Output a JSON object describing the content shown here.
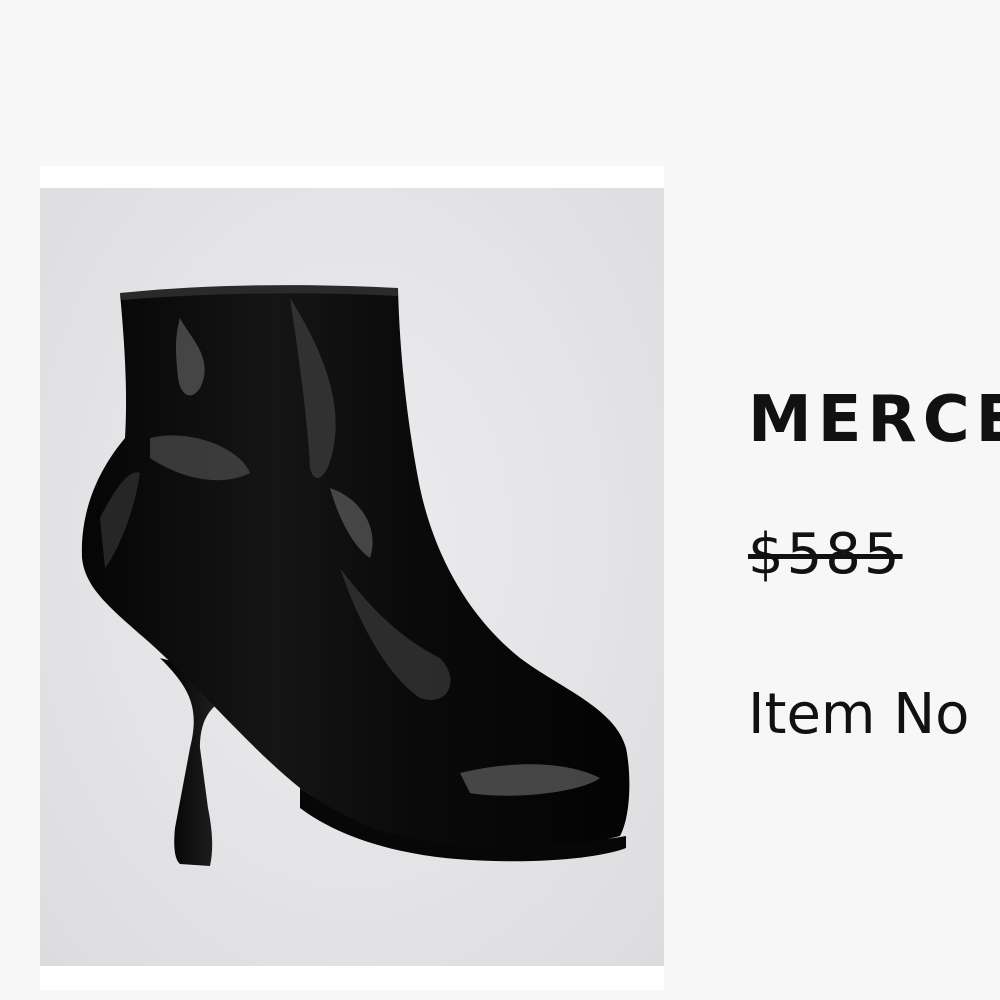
{
  "product": {
    "image_alt": "Black patent leather ankle boot with sculpted flared heel",
    "title": "MERCE",
    "price": "$585",
    "item_no_label": "Item No"
  },
  "colors": {
    "background": "#f7f7f7",
    "card": "#ffffff",
    "text": "#111111"
  }
}
